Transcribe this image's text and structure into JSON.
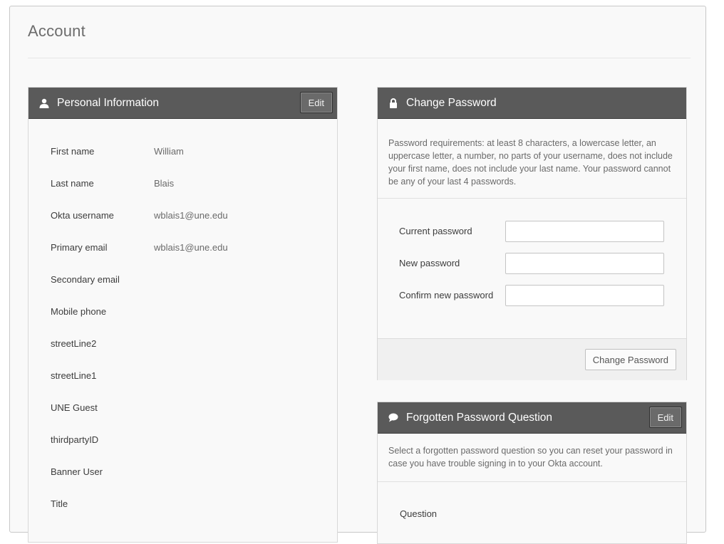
{
  "page": {
    "title": "Account"
  },
  "personal_info": {
    "title": "Personal Information",
    "edit_label": "Edit",
    "icon": "user-icon",
    "fields": [
      {
        "label": "First name",
        "value": "William"
      },
      {
        "label": "Last name",
        "value": "Blais"
      },
      {
        "label": "Okta username",
        "value": "wblais1@une.edu"
      },
      {
        "label": "Primary email",
        "value": "wblais1@une.edu"
      },
      {
        "label": "Secondary email",
        "value": ""
      },
      {
        "label": "Mobile phone",
        "value": ""
      },
      {
        "label": "streetLine2",
        "value": ""
      },
      {
        "label": "streetLine1",
        "value": ""
      },
      {
        "label": "UNE Guest",
        "value": ""
      },
      {
        "label": "thirdpartyID",
        "value": ""
      },
      {
        "label": "Banner User",
        "value": ""
      },
      {
        "label": "Title",
        "value": ""
      }
    ]
  },
  "change_password": {
    "title": "Change Password",
    "icon": "lock-icon",
    "requirements": "Password requirements: at least 8 characters, a lowercase letter, an uppercase letter, a number, no parts of your username, does not include your first name, does not include your last name. Your password cannot be any of your last 4 passwords.",
    "current_label": "Current password",
    "current_value": "",
    "new_label": "New password",
    "new_value": "",
    "confirm_label": "Confirm new password",
    "confirm_value": "",
    "submit_label": "Change Password"
  },
  "forgotten_question": {
    "title": "Forgotten Password Question",
    "icon": "speech-bubble-icon",
    "edit_label": "Edit",
    "description": "Select a forgotten password question so you can reset your password in case you have trouble signing in to your Okta account.",
    "question_label": "Question"
  },
  "colors": {
    "header_bg": "#5a5a5a",
    "page_bg": "#f9f9f9",
    "text": "#3c3c3c",
    "muted_text": "#6a6a6a"
  }
}
